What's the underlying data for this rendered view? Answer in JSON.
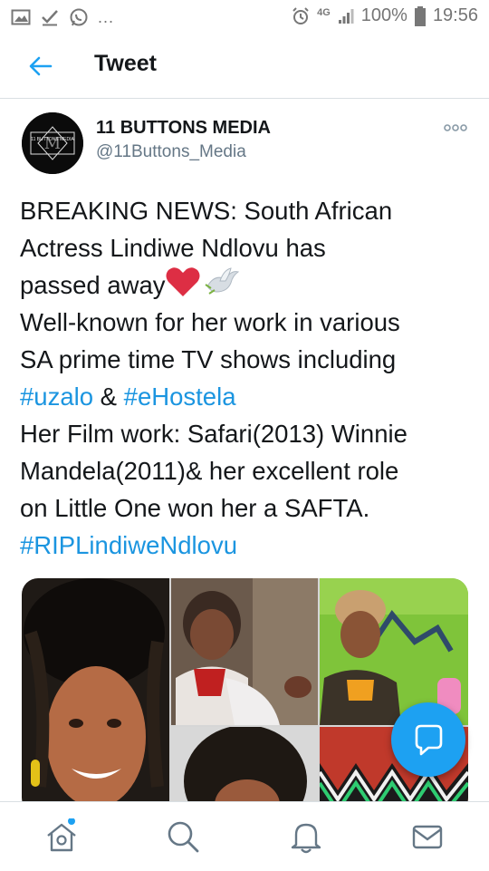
{
  "status_bar": {
    "icons_left": [
      "image-icon",
      "check-icon",
      "whatsapp-icon"
    ],
    "more_dots": "...",
    "network": "4G",
    "battery": "100%",
    "time": "19:56"
  },
  "header": {
    "title": "Tweet"
  },
  "tweet": {
    "author_name": "11 BUTTONS MEDIA",
    "author_handle": "@11Buttons_Media",
    "avatar_text": "11 BUTTONS MEDIA",
    "avatar_monogram": "M",
    "lines": [
      {
        "segments": [
          {
            "text": "BREAKING NEWS: South African",
            "tag": false
          }
        ]
      },
      {
        "segments": [
          {
            "text": "Actress Lindiwe Ndlovu has",
            "tag": false
          }
        ]
      },
      {
        "segments": [
          {
            "text": "passed away",
            "tag": false
          }
        ]
      },
      {
        "segments": [
          {
            "text": "Well-known for her work in various",
            "tag": false
          }
        ]
      },
      {
        "segments": [
          {
            "text": "SA prime time TV shows including",
            "tag": false
          }
        ]
      },
      {
        "segments": [
          {
            "text": "#uzalo",
            "tag": true
          },
          {
            "text": " & ",
            "tag": false
          },
          {
            "text": "#eHostela",
            "tag": true
          }
        ]
      },
      {
        "segments": [
          {
            "text": "Her Film work: Safari(2013) Winnie",
            "tag": false
          }
        ]
      },
      {
        "segments": [
          {
            "text": "Mandela(2011)& her excellent role",
            "tag": false
          }
        ]
      },
      {
        "segments": [
          {
            "text": "on Little One won her a SAFTA.",
            "tag": false
          }
        ]
      },
      {
        "segments": [
          {
            "text": "#RIPLindiweNdlovu",
            "tag": true
          }
        ]
      }
    ],
    "emojis": [
      "red-heart-icon",
      "dove-icon"
    ]
  },
  "media": {
    "tiles": [
      "portrait-photo",
      "tv-still-photo",
      "award-photo",
      "portrait-photo-2",
      "beadwork-photo"
    ]
  },
  "fab": {
    "icon": "compose-reply-icon"
  },
  "bottom_nav": {
    "items": [
      {
        "name": "home",
        "icon": "home-icon",
        "badge": true
      },
      {
        "name": "search",
        "icon": "search-icon",
        "badge": false
      },
      {
        "name": "notifications",
        "icon": "bell-icon",
        "badge": false
      },
      {
        "name": "messages",
        "icon": "mail-icon",
        "badge": false
      }
    ]
  },
  "colors": {
    "accent": "#1da1f2",
    "link": "#1b95e0",
    "text": "#14171a",
    "secondary_text": "#657786"
  }
}
